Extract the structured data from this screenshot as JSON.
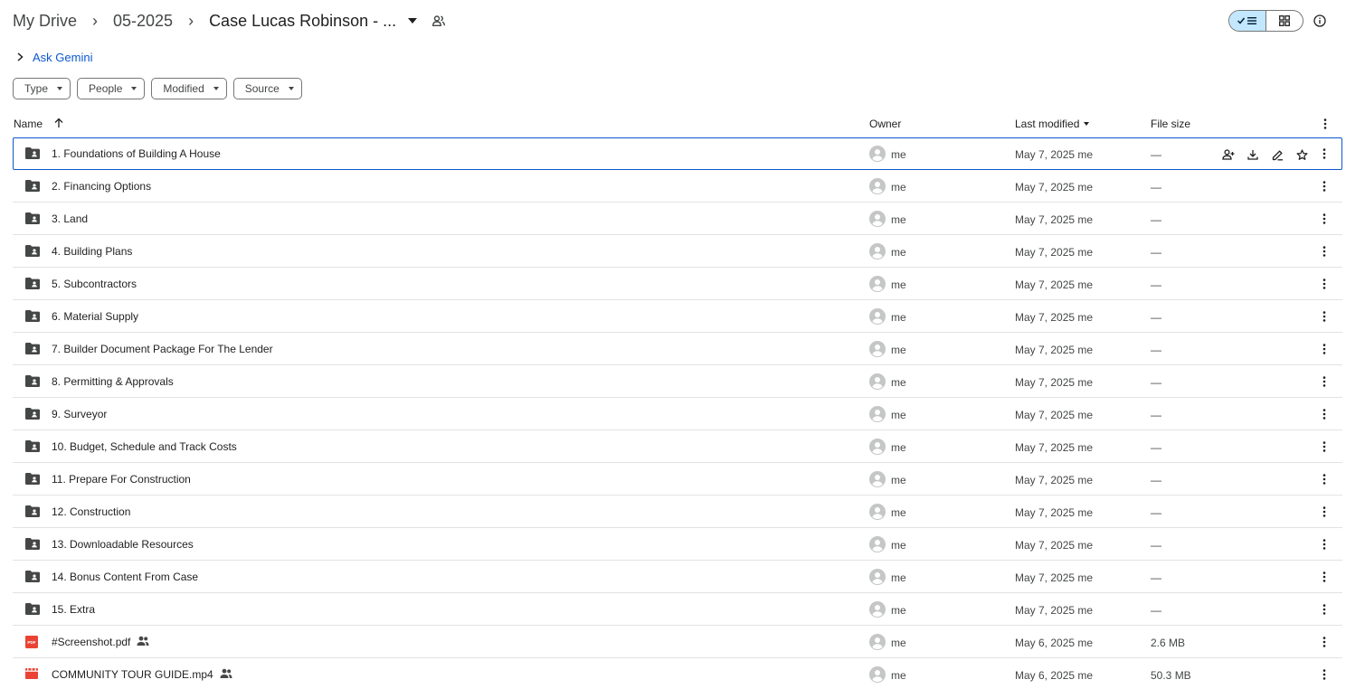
{
  "breadcrumb": {
    "root": "My Drive",
    "parent": "05-2025",
    "current": "Case Lucas Robinson - ...",
    "separator": ">"
  },
  "icons": {
    "view_list": "check-list-icon",
    "view_grid": "grid-icon",
    "info": "info-icon",
    "folder": "shared-folder-icon",
    "pdf": "pdf-icon",
    "video": "video-icon"
  },
  "colors": {
    "accent": "#0b57d0",
    "toggle_active": "#c2e7ff",
    "pdf": "#ea4335",
    "video": "#ea4335"
  },
  "ask_gemini": "Ask Gemini",
  "filters": [
    "Type",
    "People",
    "Modified",
    "Source"
  ],
  "columns": {
    "name": "Name",
    "owner": "Owner",
    "last_modified": "Last modified",
    "file_size": "File size"
  },
  "rows": [
    {
      "name": "1. Foundations of Building A House",
      "type": "folder",
      "owner": "me",
      "modified": "May 7, 2025 me",
      "size": "—",
      "shared": false,
      "selected": true
    },
    {
      "name": "2. Financing Options",
      "type": "folder",
      "owner": "me",
      "modified": "May 7, 2025 me",
      "size": "—",
      "shared": false
    },
    {
      "name": "3. Land",
      "type": "folder",
      "owner": "me",
      "modified": "May 7, 2025 me",
      "size": "—",
      "shared": false
    },
    {
      "name": "4. Building Plans",
      "type": "folder",
      "owner": "me",
      "modified": "May 7, 2025 me",
      "size": "—",
      "shared": false
    },
    {
      "name": "5. Subcontractors",
      "type": "folder",
      "owner": "me",
      "modified": "May 7, 2025 me",
      "size": "—",
      "shared": false
    },
    {
      "name": "6. Material Supply",
      "type": "folder",
      "owner": "me",
      "modified": "May 7, 2025 me",
      "size": "—",
      "shared": false
    },
    {
      "name": "7. Builder Document Package For The Lender",
      "type": "folder",
      "owner": "me",
      "modified": "May 7, 2025 me",
      "size": "—",
      "shared": false
    },
    {
      "name": "8. Permitting & Approvals",
      "type": "folder",
      "owner": "me",
      "modified": "May 7, 2025 me",
      "size": "—",
      "shared": false
    },
    {
      "name": "9. Surveyor",
      "type": "folder",
      "owner": "me",
      "modified": "May 7, 2025 me",
      "size": "—",
      "shared": false
    },
    {
      "name": "10. Budget, Schedule and Track Costs",
      "type": "folder",
      "owner": "me",
      "modified": "May 7, 2025 me",
      "size": "—",
      "shared": false
    },
    {
      "name": "11. Prepare For Construction",
      "type": "folder",
      "owner": "me",
      "modified": "May 7, 2025 me",
      "size": "—",
      "shared": false
    },
    {
      "name": "12. Construction",
      "type": "folder",
      "owner": "me",
      "modified": "May 7, 2025 me",
      "size": "—",
      "shared": false
    },
    {
      "name": "13. Downloadable Resources",
      "type": "folder",
      "owner": "me",
      "modified": "May 7, 2025 me",
      "size": "—",
      "shared": false
    },
    {
      "name": "14. Bonus Content From Case",
      "type": "folder",
      "owner": "me",
      "modified": "May 7, 2025 me",
      "size": "—",
      "shared": false
    },
    {
      "name": "15. Extra",
      "type": "folder",
      "owner": "me",
      "modified": "May 7, 2025 me",
      "size": "—",
      "shared": false
    },
    {
      "name": "#Screenshot.pdf",
      "type": "pdf",
      "owner": "me",
      "modified": "May 6, 2025 me",
      "size": "2.6 MB",
      "shared": true
    },
    {
      "name": "COMMUNITY TOUR GUIDE.mp4",
      "type": "video",
      "owner": "me",
      "modified": "May 6, 2025 me",
      "size": "50.3 MB",
      "shared": true
    }
  ],
  "row_actions": [
    "share-icon",
    "download-icon",
    "rename-icon",
    "star-icon"
  ]
}
